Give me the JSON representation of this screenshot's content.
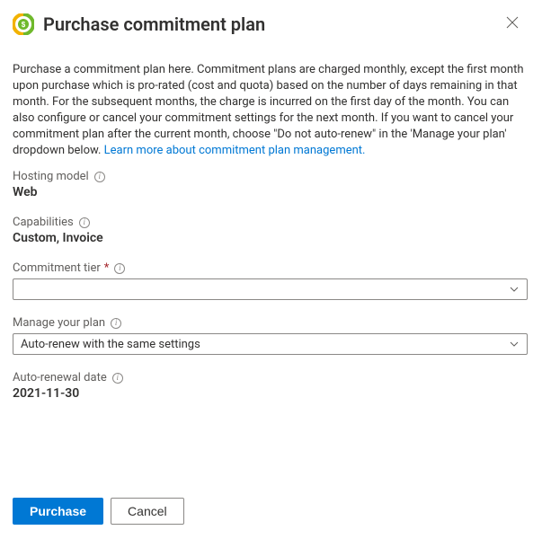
{
  "header": {
    "title": "Purchase commitment plan"
  },
  "intro": {
    "text": "Purchase a commitment plan here. Commitment plans are charged monthly, except the first month upon purchase which is pro-rated (cost and quota) based on the number of days remaining in that month. For the subsequent months, the charge is incurred on the first day of the month. You can also configure or cancel your commitment settings for the next month. If you want to cancel your commitment plan after the current month, choose \"Do not auto-renew\" in the 'Manage your plan' dropdown below. ",
    "link_text": "Learn more about commitment plan management."
  },
  "fields": {
    "hosting_model": {
      "label": "Hosting model",
      "value": "Web"
    },
    "capabilities": {
      "label": "Capabilities",
      "value": "Custom, Invoice"
    },
    "commitment_tier": {
      "label": "Commitment tier",
      "value": "",
      "required_marker": "*"
    },
    "manage_plan": {
      "label": "Manage your plan",
      "value": "Auto-renew with the same settings"
    },
    "auto_renewal_date": {
      "label": "Auto-renewal date",
      "value": "2021-11-30"
    }
  },
  "footer": {
    "purchase": "Purchase",
    "cancel": "Cancel"
  }
}
